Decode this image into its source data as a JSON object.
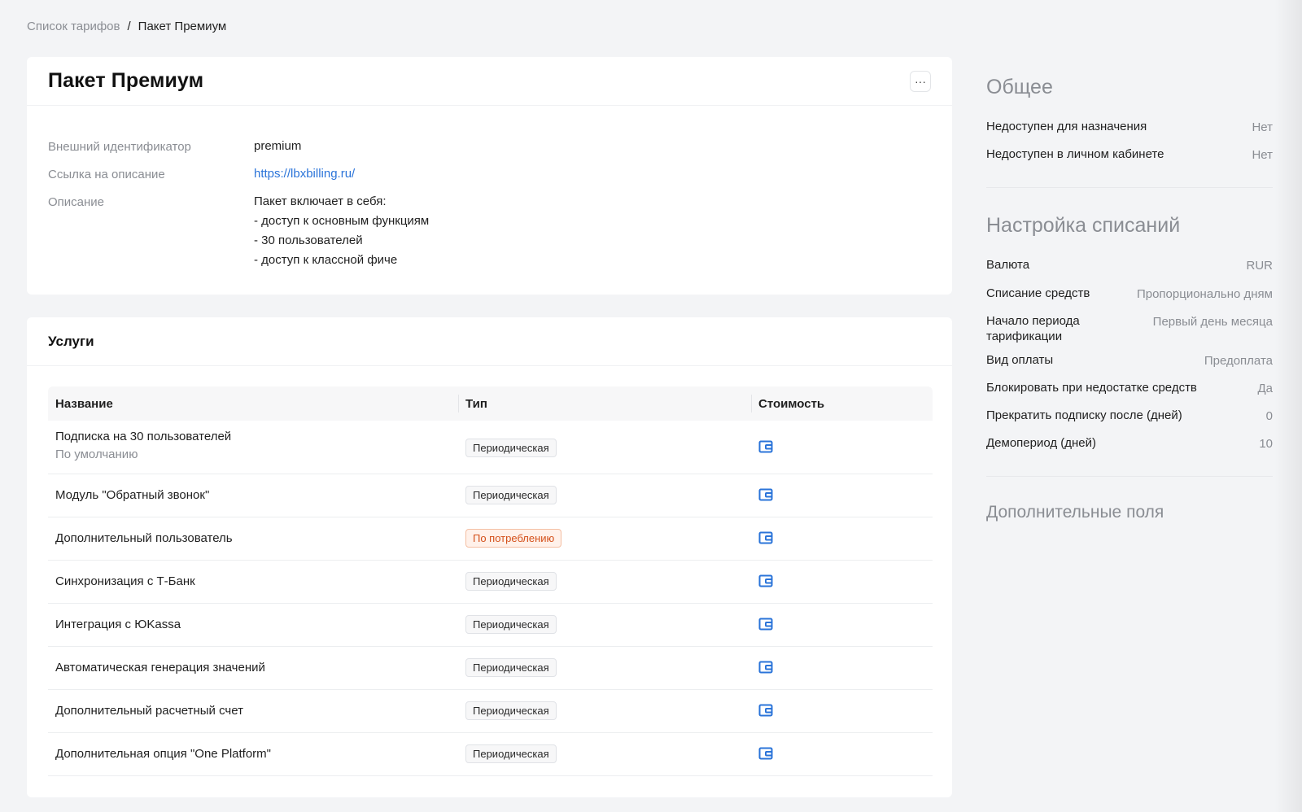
{
  "breadcrumb": {
    "parent": "Список тарифов",
    "separator": "/",
    "current": "Пакет Премиум"
  },
  "header": {
    "title": "Пакет Премиум",
    "more_label": "···"
  },
  "properties": {
    "external_id_label": "Внешний идентификатор",
    "external_id_value": "premium",
    "link_label": "Ссылка на описание",
    "link_value": "https://lbxbilling.ru/",
    "description_label": "Описание",
    "description_lines": [
      "Пакет включает в себя:",
      "- доступ к основным функциям",
      "- 30 пользователей",
      "- доступ к классной фиче"
    ]
  },
  "services": {
    "title": "Услуги",
    "columns": {
      "name": "Название",
      "type": "Тип",
      "cost": "Стоимость"
    },
    "rows": [
      {
        "name": "Подписка на 30 пользователей",
        "sub": "По умолчанию",
        "type": "Периодическая"
      },
      {
        "name": "Модуль \"Обратный звонок\"",
        "type": "Периодическая"
      },
      {
        "name": "Дополнительный пользователь",
        "type": "По потреблению"
      },
      {
        "name": "Синхронизация с Т-Банк",
        "type": "Периодическая"
      },
      {
        "name": "Интеграция с ЮKassa",
        "type": "Периодическая"
      },
      {
        "name": "Автоматическая генерация значений",
        "type": "Периодическая"
      },
      {
        "name": "Дополнительный расчетный счет",
        "type": "Периодическая"
      },
      {
        "name": "Дополнительная опция \"One Platform\"",
        "type": "Периодическая"
      }
    ]
  },
  "sidebar": {
    "general": {
      "title": "Общее",
      "items": [
        {
          "label": "Недоступен для назначения",
          "value": "Нет"
        },
        {
          "label": "Недоступен в личном кабинете",
          "value": "Нет"
        }
      ]
    },
    "billing": {
      "title": "Настройка списаний",
      "items": [
        {
          "label": "Валюта",
          "value": "RUR"
        },
        {
          "label": "Списание средств",
          "value": "Пропорционально дням"
        },
        {
          "label": "Начало периода тарификации",
          "value": "Первый день месяца"
        },
        {
          "label": "Вид оплаты",
          "value": "Предоплата"
        },
        {
          "label": "Блокировать при недостатке средств",
          "value": "Да"
        },
        {
          "label": "Прекратить подписку после (дней)",
          "value": "0"
        },
        {
          "label": "Демопериод (дней)",
          "value": "10"
        }
      ]
    },
    "extra": {
      "title": "Дополнительные поля"
    }
  },
  "colors": {
    "accent": "#2b74d9",
    "orange_badge": "#d4501a",
    "muted": "#8a8d93"
  },
  "icons": {
    "cost": "wallet-icon",
    "more": "ellipsis-icon"
  }
}
